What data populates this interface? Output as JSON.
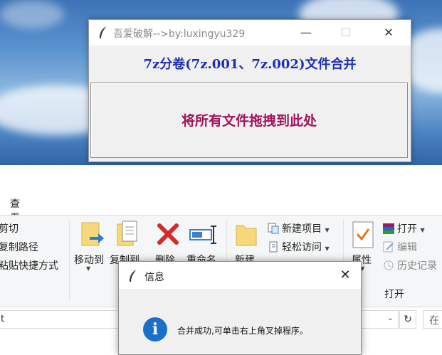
{
  "tk_window": {
    "title": "吾爱破解-->by:luxingyu329",
    "heading": "7z分卷(7z.001、7z.002)文件合并",
    "drop_text": "将所有文件拖拽到此处",
    "minimize": "—",
    "maximize": "☐",
    "close": "✕",
    "heading_color": "#1d2fb0",
    "drop_color": "#a0145a"
  },
  "explorer": {
    "tab_view": "查看",
    "clipboard": {
      "cut": "剪切",
      "copy_path": "复制路径",
      "paste_shortcut": "粘贴快捷方式"
    },
    "organize": {
      "move_to": "移动到",
      "copy_to": "复制到",
      "delete": "删除",
      "rename": "重命名"
    },
    "new": {
      "new_folder": "新建",
      "new_item": "新建项目",
      "easy_access": "轻松访问"
    },
    "open": {
      "properties": "属性",
      "open": "打开",
      "edit": "编辑",
      "history": "历史记录",
      "group_label": "打开"
    },
    "address_text": "t",
    "refresh": "↻",
    "search_text": "在"
  },
  "dialog": {
    "title": "信息",
    "close": "✕",
    "icon_glyph": "i",
    "message": "合并成功,可单击右上角叉掉程序。"
  }
}
